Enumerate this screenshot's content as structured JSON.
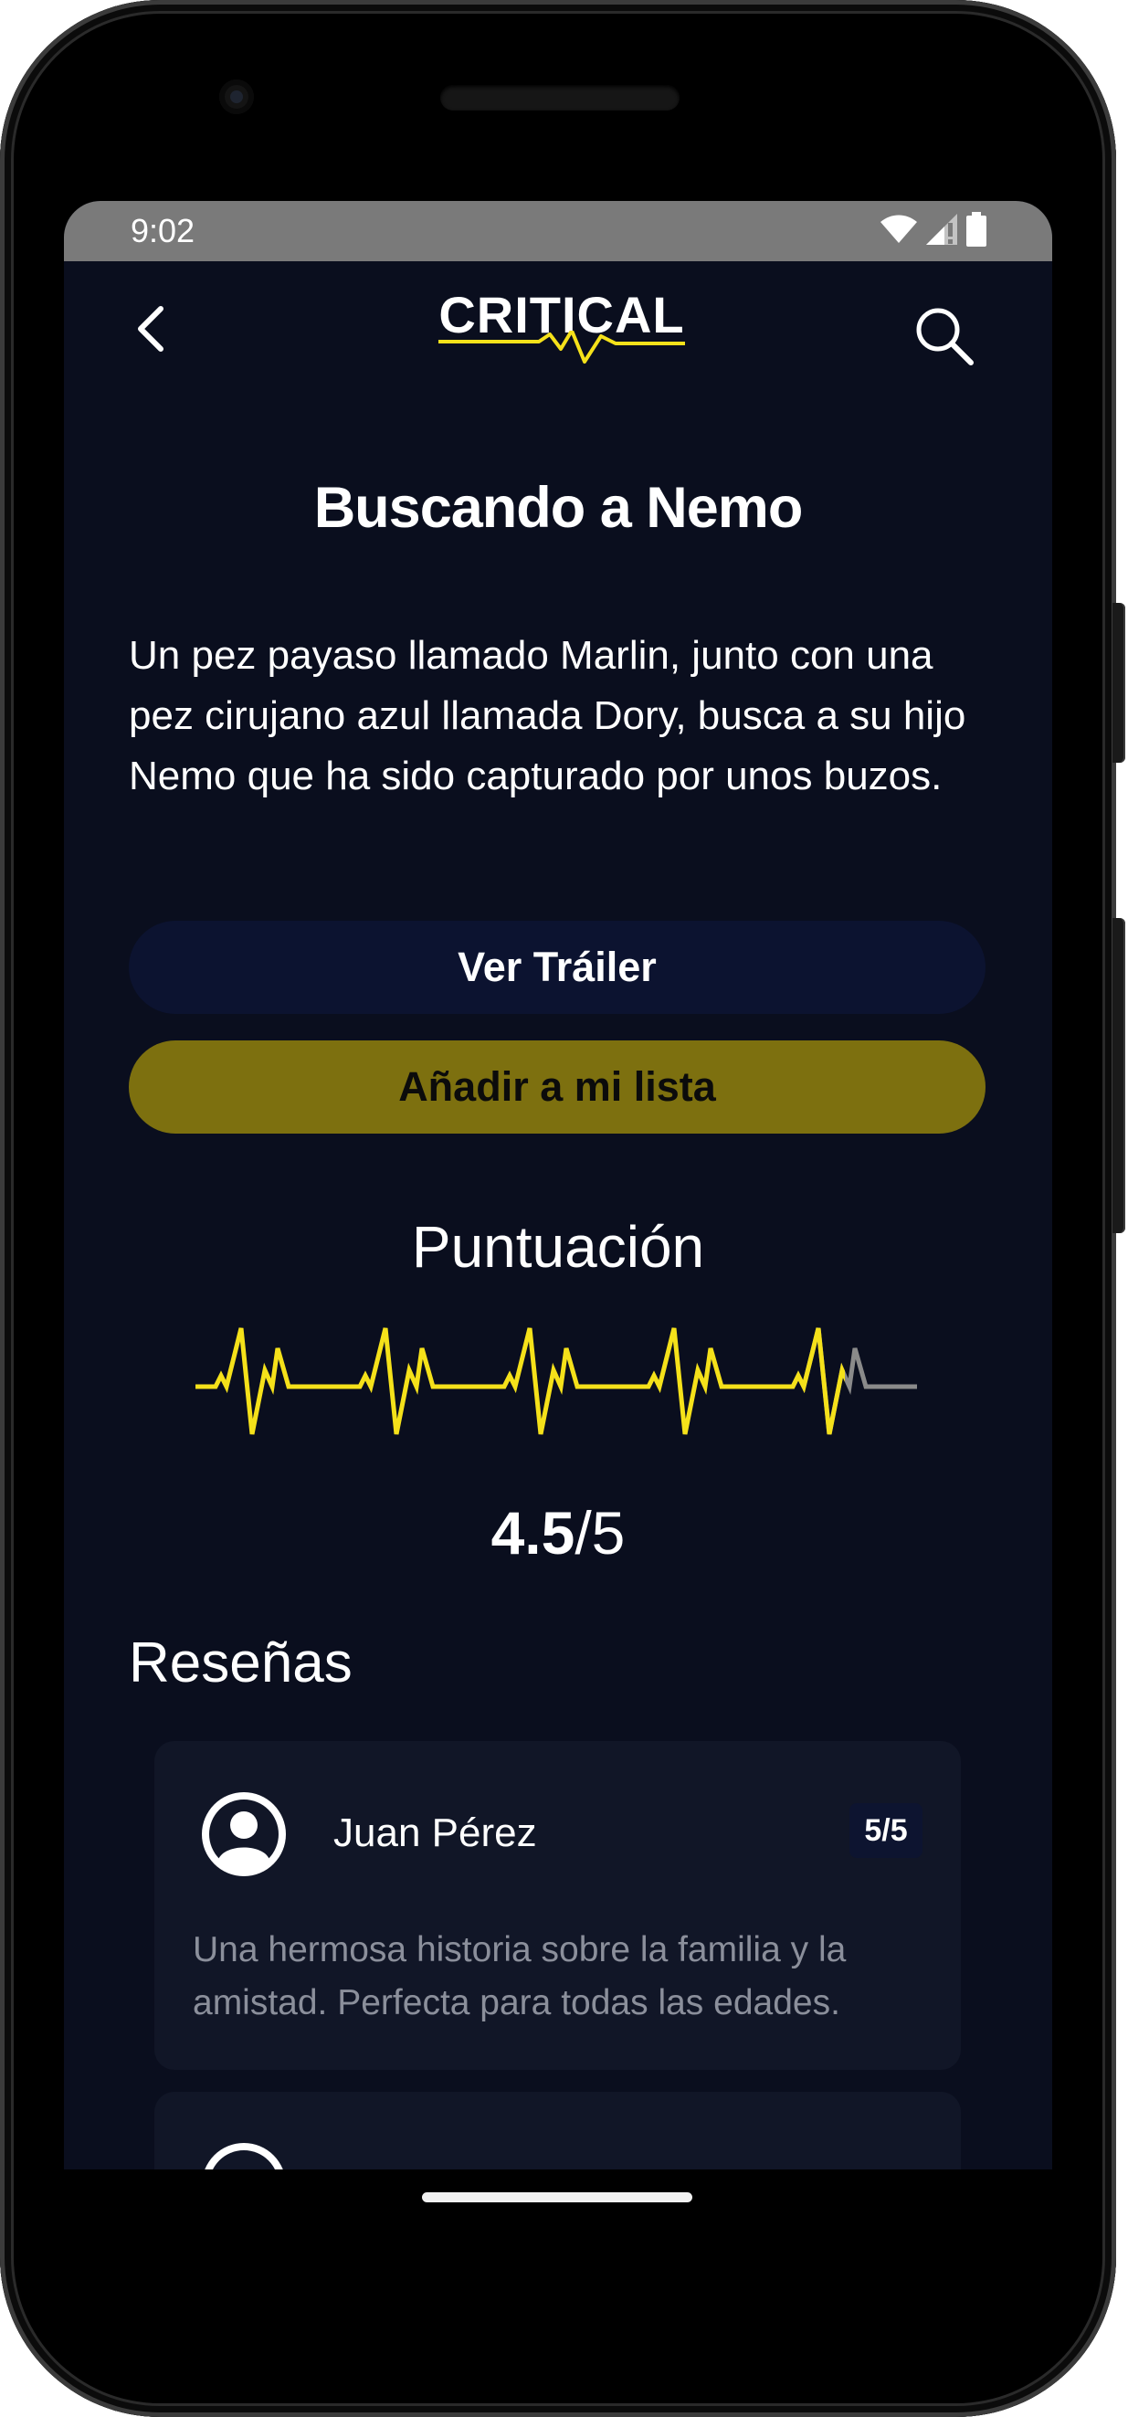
{
  "status_bar": {
    "time": "9:02",
    "icons": [
      "wifi-icon",
      "signal-icon",
      "battery-icon"
    ]
  },
  "header": {
    "logo_text": "CRITICAL",
    "back_icon": "chevron-left-icon",
    "search_icon": "search-icon"
  },
  "movie": {
    "title": "Buscando a Nemo",
    "synopsis": "Un pez payaso llamado Marlin, junto con una pez cirujano azul llamada Dory, busca a su hijo Nemo que ha sido capturado por unos buzos."
  },
  "actions": {
    "trailer_label": "Ver Tráiler",
    "list_label": "Añadir a mi lista"
  },
  "score": {
    "title": "Puntuación",
    "value": "4.5",
    "max": "/5",
    "rating": 4.5,
    "out_of": 5
  },
  "reviews": {
    "title": "Reseñas",
    "items": [
      {
        "author": "Juan Pérez",
        "rating": "5/5",
        "text": "Una hermosa historia sobre la familia y la amistad. Perfecta para todas las edades."
      }
    ]
  },
  "colors": {
    "background": "#0a0e1e",
    "accent_yellow": "#f5e11a",
    "button_list": "#7d700f",
    "button_trailer": "#0c1330",
    "card": "#111627",
    "inactive_wave": "#8a8a8a"
  }
}
